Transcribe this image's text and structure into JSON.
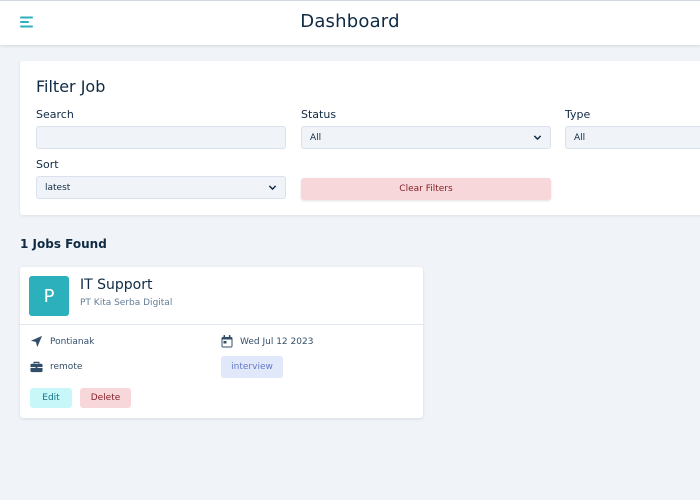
{
  "header": {
    "title": "Dashboard",
    "menu_icon": "menu-left-icon"
  },
  "filter": {
    "title": "Filter Job",
    "search": {
      "label": "Search",
      "value": "",
      "placeholder": ""
    },
    "status": {
      "label": "Status",
      "value": "All"
    },
    "type": {
      "label": "Type",
      "value": "All"
    },
    "sort": {
      "label": "Sort",
      "value": "latest"
    },
    "clear_label": "Clear Filters"
  },
  "results": {
    "count_label": "1 Jobs Found"
  },
  "jobs": [
    {
      "avatar_letter": "P",
      "title": "IT Support",
      "company": "PT Kita Serba Digital",
      "location": "Pontianak",
      "date": "Wed Jul 12 2023",
      "job_type": "remote",
      "status": "interview",
      "edit_label": "Edit",
      "delete_label": "Delete"
    }
  ],
  "colors": {
    "accent": "#2cb1bc",
    "page_background": "#f0f4f8",
    "danger_background": "#f8d7da",
    "status_interview_background": "#e0e8f9"
  }
}
